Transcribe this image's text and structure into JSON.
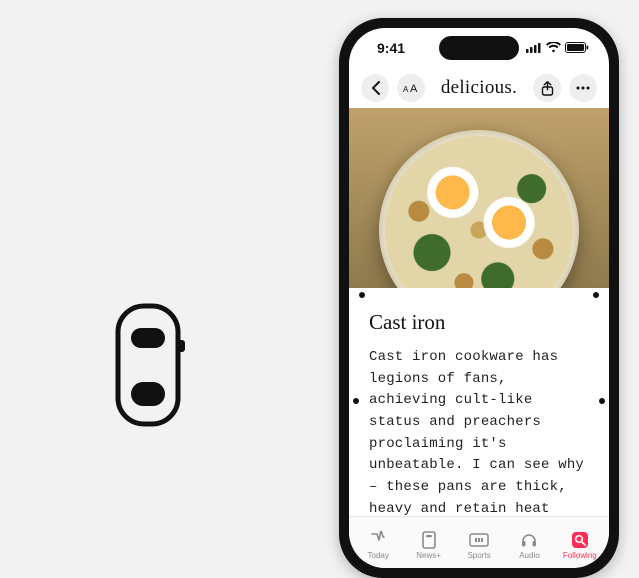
{
  "status": {
    "time": "9:41"
  },
  "nav": {
    "title": "delicious."
  },
  "article": {
    "title": "Cast iron",
    "body": "Cast iron cookware has legions of fans, achieving cult-like status and preachers proclaiming it's unbeatable. I can see why – these pans are thick, heavy and retain heat like no other. They're unmatched for meat that needs a strong sear; hav-"
  },
  "tabs": {
    "today": "Today",
    "newsplus": "News+",
    "sports": "Sports",
    "audio": "Audio",
    "following": "Following"
  }
}
